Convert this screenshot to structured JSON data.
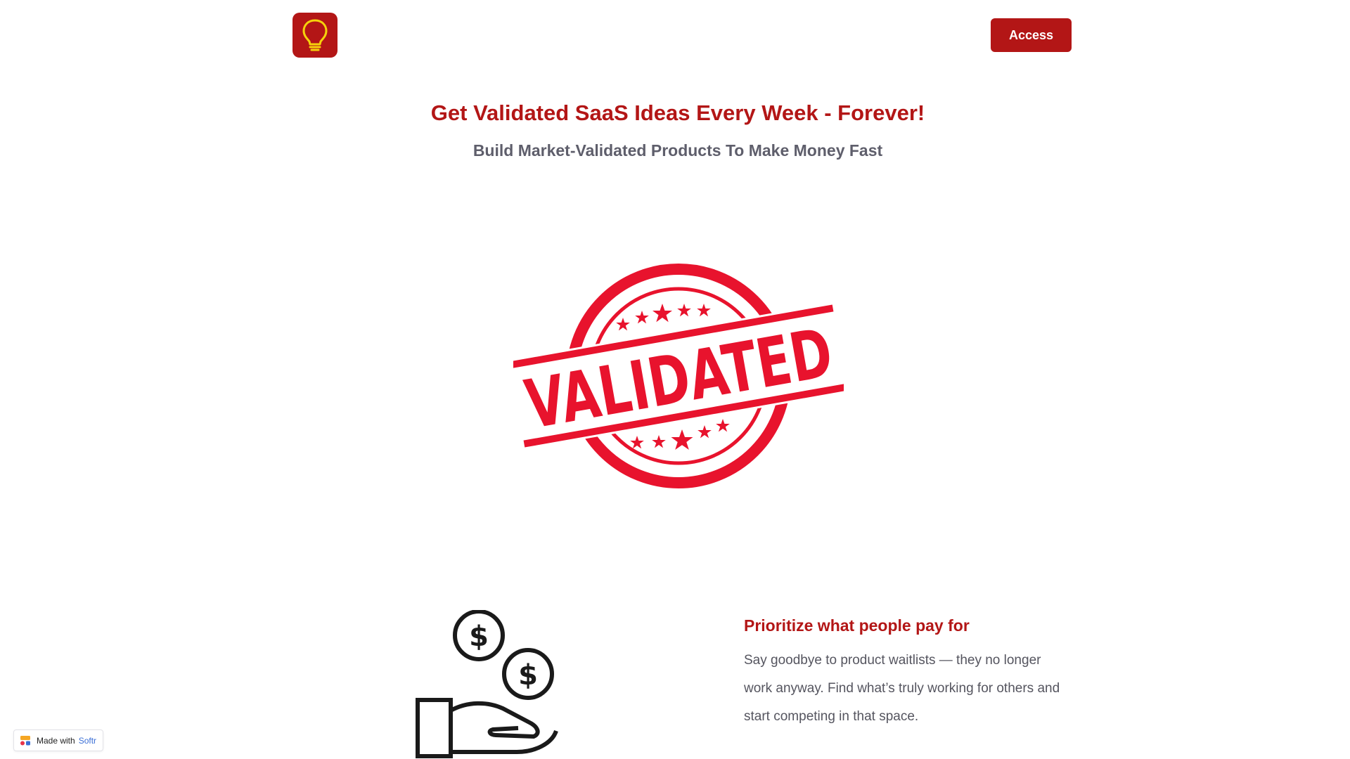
{
  "header": {
    "logo_icon": "lightbulb-icon",
    "access_label": "Access"
  },
  "hero": {
    "title": "Get Validated SaaS Ideas Every Week - Forever!",
    "subtitle": "Build Market-Validated Products To Make Money Fast",
    "stamp_text": "VALIDATED",
    "stamp_icon": "validated-stamp-icon"
  },
  "feature": {
    "icon": "hand-coins-icon",
    "title": "Prioritize what people pay for",
    "description": "Say goodbye to product waitlists — they no longer work anyway. Find what’s truly working for others and start competing in that space."
  },
  "badge": {
    "prefix": "Made with",
    "brand": "Softr"
  },
  "colors": {
    "brand_red": "#b31616",
    "stamp_red": "#e8132d",
    "subtitle_gray": "#5e5e6b",
    "bulb_yellow": "#f5d20b"
  }
}
